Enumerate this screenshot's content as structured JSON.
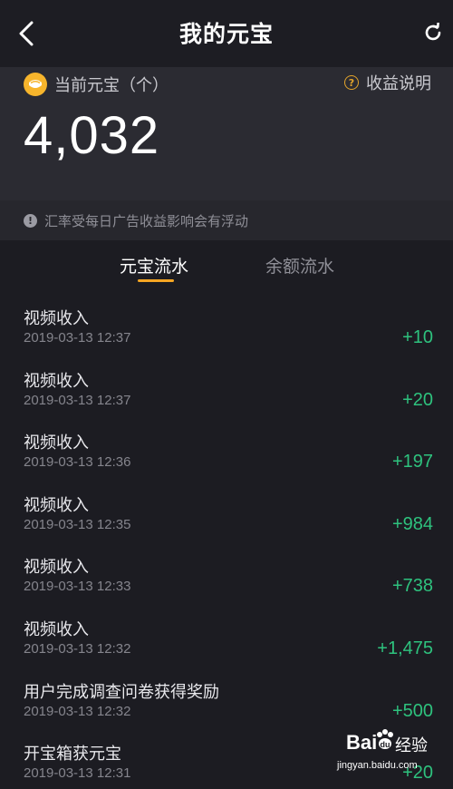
{
  "header": {
    "title": "我的元宝",
    "back_icon": "chevron-left-icon",
    "refresh_icon": "refresh-icon"
  },
  "summary": {
    "label": "当前元宝（个）",
    "help_label": "收益说明",
    "balance": "4,032",
    "coin_color": "#f7b52c"
  },
  "notice": {
    "text": "汇率受每日广告收益影响会有浮动"
  },
  "tabs": [
    {
      "label": "元宝流水",
      "active": true
    },
    {
      "label": "余额流水",
      "active": false
    }
  ],
  "records": [
    {
      "title": "视频收入",
      "time": "2019-03-13 12:37",
      "amount": "+10"
    },
    {
      "title": "视频收入",
      "time": "2019-03-13 12:37",
      "amount": "+20"
    },
    {
      "title": "视频收入",
      "time": "2019-03-13 12:36",
      "amount": "+197"
    },
    {
      "title": "视频收入",
      "time": "2019-03-13 12:35",
      "amount": "+984"
    },
    {
      "title": "视频收入",
      "time": "2019-03-13 12:33",
      "amount": "+738"
    },
    {
      "title": "视频收入",
      "time": "2019-03-13 12:32",
      "amount": "+1,475"
    },
    {
      "title": "用户完成调查问卷获得奖励",
      "time": "2019-03-13 12:32",
      "amount": "+500"
    },
    {
      "title": "开宝箱获元宝",
      "time": "2019-03-13 12:31",
      "amount": "+20"
    }
  ],
  "watermark": {
    "logo": "Bai",
    "text": "经验",
    "url": "jingyan.baidu.com"
  },
  "colors": {
    "accent": "#f5a623",
    "positive": "#2ec27e",
    "background": "#1c1c22"
  }
}
